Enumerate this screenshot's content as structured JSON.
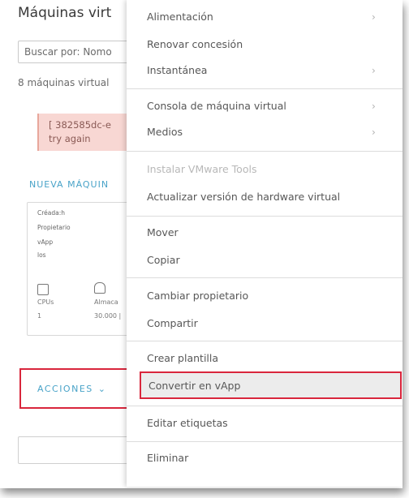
{
  "background": {
    "title": "Máquinas virt",
    "search_label": "Buscar por: Nomo",
    "vm_count": "8 máquinas virtual",
    "error_line1": "[ 382585dc-e",
    "error_line2": "try again",
    "new_vm": "NUEVA MÁQUIN",
    "card": {
      "line1": "Créada:h",
      "line2": "Propietario",
      "line3": "vApp",
      "line4": "los",
      "cpu_label": "CPUs",
      "cpu_value": "1",
      "storage_label": "Almaca",
      "storage_value": "30.000 |"
    },
    "actions_label": "ACCIONES",
    "actions_chevron": "⌄"
  },
  "menu": {
    "items": [
      {
        "label": "Alimentación",
        "submenu": true
      },
      {
        "label": "Renovar concesión",
        "submenu": false
      },
      {
        "label": "Instantánea",
        "submenu": true
      },
      {
        "label": "Consola de máquina virtual",
        "submenu": true
      },
      {
        "label": "Medios",
        "submenu": true
      },
      {
        "label": "Instalar VMware Tools",
        "submenu": false,
        "disabled": true
      },
      {
        "label": "Actualizar versión de hardware virtual",
        "submenu": false
      },
      {
        "label": "Mover",
        "submenu": false
      },
      {
        "label": "Copiar",
        "submenu": false
      },
      {
        "label": "Cambiar propietario",
        "submenu": false
      },
      {
        "label": "Compartir",
        "submenu": false
      },
      {
        "label": "Crear plantilla",
        "submenu": false
      },
      {
        "label": "Convertir en vApp",
        "submenu": false,
        "highlighted": true
      },
      {
        "label": "Editar etiquetas",
        "submenu": false
      },
      {
        "label": "Eliminar",
        "submenu": false
      }
    ],
    "submenu_icon": "chevron-right-icon"
  },
  "colors": {
    "highlight_border": "#d9263c",
    "link_blue": "#49a3c8",
    "error_bg": "#f8d7d3"
  }
}
